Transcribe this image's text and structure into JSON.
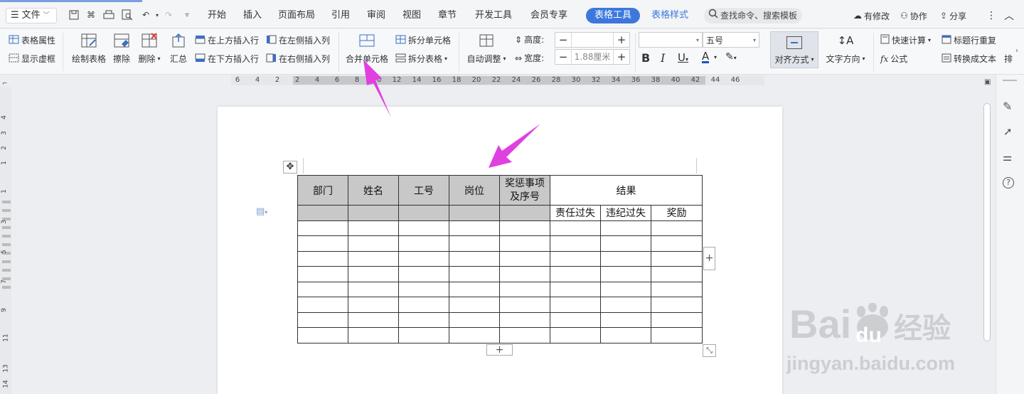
{
  "menubar": {
    "file_label": "文件",
    "tabs": [
      "开始",
      "插入",
      "页面布局",
      "引用",
      "审阅",
      "视图",
      "章节",
      "开发工具",
      "会员专享"
    ],
    "active_tab": "表格工具",
    "style_tab": "表格样式",
    "search_placeholder": "查找命令、搜索模板",
    "modified_label": "有修改",
    "collab_label": "协作",
    "share_label": "分享"
  },
  "ribbon": {
    "table_props": "表格属性",
    "show_gridlines": "显示虚框",
    "draw_table": "绘制表格",
    "erase": "擦除",
    "delete": "删除",
    "summary": "汇总",
    "insert_above": "在上方插入行",
    "insert_below": "在下方插入行",
    "insert_left": "在左侧插入列",
    "insert_right": "在右侧插入列",
    "merge_cells": "合并单元格",
    "split_cells": "拆分单元格",
    "split_table": "拆分表格",
    "auto_fit": "自动调整",
    "height_label": "高度:",
    "height_value": "",
    "width_label": "宽度:",
    "width_value": "1.88厘米",
    "font_name": "",
    "font_size": "五号",
    "align": "对齐方式",
    "text_direction": "文字方向",
    "quick_calc": "快速计算",
    "formula": "公式",
    "repeat_header": "标题行重复",
    "convert_text": "转换成文本",
    "sort_partial": "排"
  },
  "ruler": {
    "ticks": [
      "6",
      "4",
      "2",
      "2",
      "4",
      "6",
      "8",
      "10",
      "12",
      "14",
      "16",
      "18",
      "20",
      "22",
      "24",
      "26",
      "28",
      "30",
      "32",
      "34",
      "36",
      "38",
      "40",
      "42",
      "44",
      "46"
    ],
    "vticks": [
      "4",
      "3",
      "2",
      "1",
      "1",
      "3",
      "5",
      "7",
      "9",
      "11",
      "13",
      "14"
    ]
  },
  "table": {
    "header": [
      "部门",
      "姓名",
      "工号",
      "岗位",
      "奖惩事项及序号",
      "结果"
    ],
    "sub_header": [
      "责任过失",
      "违纪过失",
      "奖励"
    ],
    "empty_rows": 8
  },
  "watermark": {
    "brand": "Bai",
    "brand2": "经验",
    "brand_du": "du",
    "url": "jingyan.baidu.com"
  },
  "colors": {
    "accent": "#3c78dc",
    "arrow": "#e040e0"
  }
}
